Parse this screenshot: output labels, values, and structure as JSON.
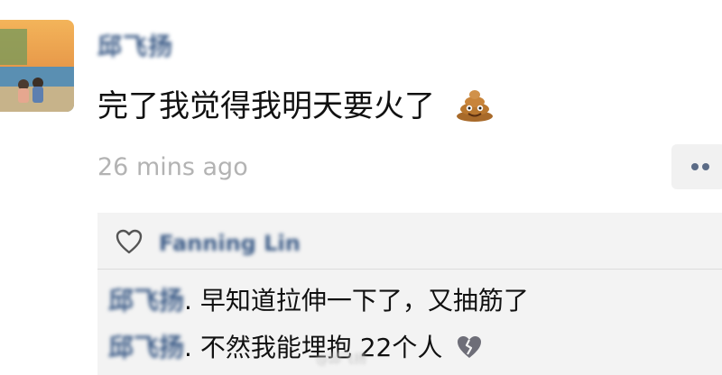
{
  "post": {
    "username": "邱飞扬",
    "text": "完了我觉得我明天要火了",
    "emoji": "poop-emoji",
    "timestamp": "26 mins ago"
  },
  "interactions": {
    "likes_names": "Fanning Lin",
    "comments": [
      {
        "author": "邱飞扬",
        "separator": ".",
        "text": " 早知道拉伸一下了，又抽筋了"
      },
      {
        "author": "邱飞扬",
        "separator": ".",
        "text": " 不然我能埋抱 22个人",
        "emoji": "broken-heart-emoji"
      }
    ]
  },
  "watermark": "@邱飞扬"
}
